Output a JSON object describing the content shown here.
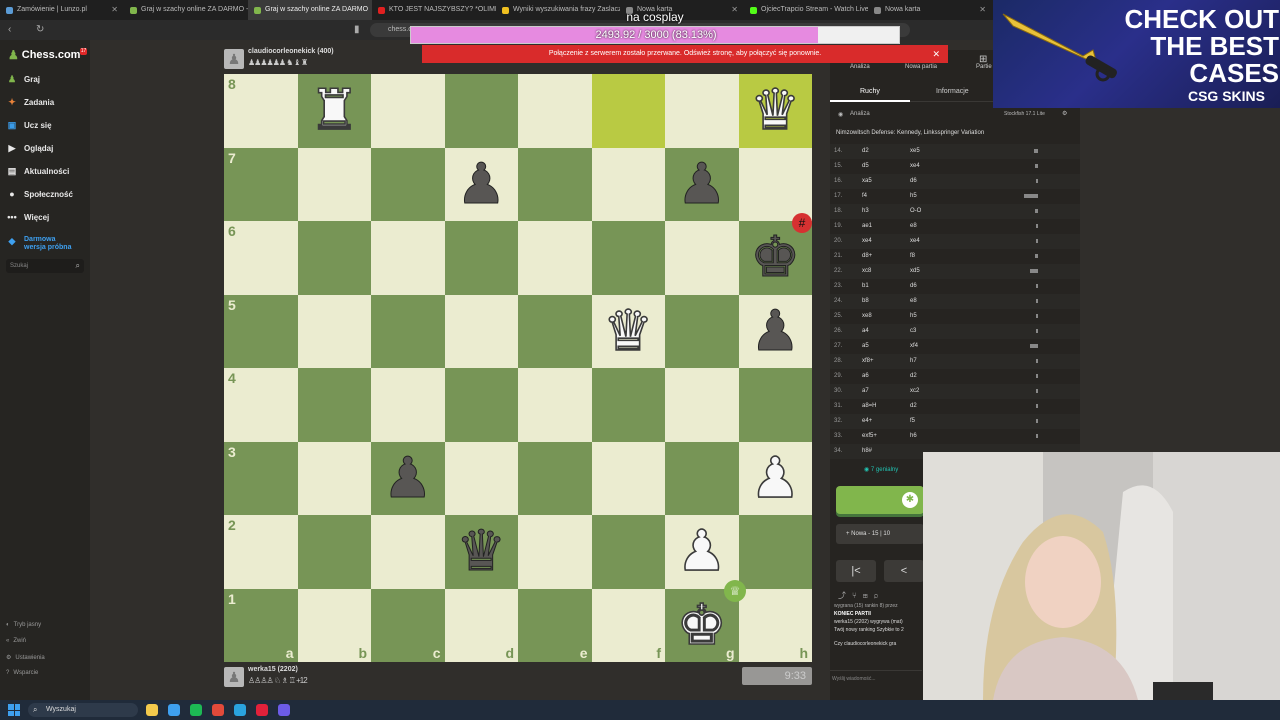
{
  "browser": {
    "tabs": [
      {
        "label": "Zamówienie | Lunzo.pl",
        "color": "#5b9bd5",
        "active": false
      },
      {
        "label": "Graj w szachy online ZA DARMO - in",
        "color": "#81b64c",
        "active": false
      },
      {
        "label": "Graj w szachy online ZA DARMO",
        "color": "#81b64c",
        "active": true
      },
      {
        "label": "KTO JEST NAJSZYBSZY? *OLIMPIAD",
        "color": "#e02020",
        "active": false
      },
      {
        "label": "Wyniki wyszukiwania frazy Zaslacz d",
        "color": "#f0c020",
        "active": false
      },
      {
        "label": "Nowa karta",
        "color": "#888888",
        "active": false
      },
      {
        "label": "OjciecTrapcio Stream - Watch Live on",
        "color": "#53fc18",
        "active": false
      },
      {
        "label": "Nowa karta",
        "color": "#888888",
        "active": false
      }
    ],
    "url": "chess.c"
  },
  "overlay": {
    "cosplay": "na cosplay",
    "goal_text": "2493.92 / 3000 (83.13%)",
    "goal_fraction": 0.8313,
    "alert": "Połączenie z serwerem zostało przerwane. Odśwież stronę, aby połączyć się ponownie."
  },
  "sidebar": {
    "logo": "Chess.com",
    "badge": "17",
    "items": [
      {
        "label": "Graj",
        "icon": "♟",
        "color": "#81b64c"
      },
      {
        "label": "Zadania",
        "icon": "✦",
        "color": "#e8823a"
      },
      {
        "label": "Ucz się",
        "icon": "▣",
        "color": "#3a9be8"
      },
      {
        "label": "Oglądaj",
        "icon": "▶",
        "color": "#e8e8e8"
      },
      {
        "label": "Aktualności",
        "icon": "▤",
        "color": "#e8e8e8"
      },
      {
        "label": "Społeczność",
        "icon": "●",
        "color": "#e8e8e8"
      },
      {
        "label": "Więcej",
        "icon": "•••",
        "color": "#e8e8e8"
      }
    ],
    "trial_line1": "Darmowa",
    "trial_line2": "wersja próbna",
    "search_placeholder": "Szukaj",
    "footer": [
      {
        "label": "Tryb jasny",
        "icon": "◐"
      },
      {
        "label": "Zwiń",
        "icon": "«"
      },
      {
        "label": "Ustawienia",
        "icon": "⚙"
      },
      {
        "label": "Wsparcie",
        "icon": "?"
      }
    ]
  },
  "top_player": {
    "name": "claudiocorleonekick (400)",
    "captures": "♟♟♟♟♟♟ ♞ ♝ ♜"
  },
  "bottom_player": {
    "name": "werka15 (2202)",
    "captures": "♙♙♙♙ ♘ ♗ ♖ +12",
    "clock": "9:33"
  },
  "board": {
    "files": [
      "a",
      "b",
      "c",
      "d",
      "e",
      "f",
      "g",
      "h"
    ],
    "ranks": [
      "8",
      "7",
      "6",
      "5",
      "4",
      "3",
      "2",
      "1"
    ],
    "highlight": [
      "f8",
      "h8"
    ],
    "pieces": {
      "b8": {
        "glyph": "♜",
        "color": "w",
        "name": "white-rook"
      },
      "h8": {
        "glyph": "♛",
        "color": "w",
        "name": "white-queen"
      },
      "d7": {
        "glyph": "♟",
        "color": "b",
        "name": "black-pawn"
      },
      "g7": {
        "glyph": "♟",
        "color": "b",
        "name": "black-pawn"
      },
      "h6": {
        "glyph": "♚",
        "color": "b",
        "name": "black-king"
      },
      "f5": {
        "glyph": "♛",
        "color": "w",
        "name": "white-queen"
      },
      "h5": {
        "glyph": "♟",
        "color": "b",
        "name": "black-pawn"
      },
      "c3": {
        "glyph": "♟",
        "color": "b",
        "name": "black-pawn"
      },
      "h3": {
        "glyph": "♟",
        "color": "w",
        "name": "white-pawn"
      },
      "d2": {
        "glyph": "♛",
        "color": "b",
        "name": "black-queen"
      },
      "g2": {
        "glyph": "♟",
        "color": "w",
        "name": "white-pawn"
      },
      "g1": {
        "glyph": "♚",
        "color": "w",
        "name": "white-king"
      }
    },
    "checkmark_icon": "checkmark-icon",
    "winner_icon": "crown-icon"
  },
  "panel": {
    "tabs": [
      "Analiza",
      "Nowa partia",
      "Partie"
    ],
    "subtabs": [
      "Ruchy",
      "Informacje"
    ],
    "engine_label": "Analiza",
    "engine_name": "Stockfish 17.1 Lite",
    "opening": "Nimzowitsch Defense: Kennedy, Linksspringer Variation",
    "moves": [
      {
        "n": "14.",
        "w": "d2",
        "b": "xe5",
        "bar": 4
      },
      {
        "n": "15.",
        "w": "d5",
        "b": "xe4",
        "bar": 3
      },
      {
        "n": "16.",
        "w": "xa5",
        "b": "d6",
        "bar": 2
      },
      {
        "n": "17.",
        "w": "f4",
        "b": "h5",
        "bar": 14
      },
      {
        "n": "18.",
        "w": "h3",
        "b": "O-O",
        "bar": 3
      },
      {
        "n": "19.",
        "w": "ae1",
        "b": "e8",
        "bar": 2
      },
      {
        "n": "20.",
        "w": "xe4",
        "b": "xe4",
        "bar": 2
      },
      {
        "n": "21.",
        "w": "d8+",
        "b": "f8",
        "bar": 3
      },
      {
        "n": "22.",
        "w": "xc8",
        "b": "xd5",
        "bar": 8
      },
      {
        "n": "23.",
        "w": "b1",
        "b": "d6",
        "bar": 2
      },
      {
        "n": "24.",
        "w": "b8",
        "b": "e8",
        "bar": 2
      },
      {
        "n": "25.",
        "w": "xe8",
        "b": "h5",
        "bar": 2
      },
      {
        "n": "26.",
        "w": "a4",
        "b": "c3",
        "bar": 2
      },
      {
        "n": "27.",
        "w": "a5",
        "b": "xf4",
        "bar": 8
      },
      {
        "n": "28.",
        "w": "xf8+",
        "b": "h7",
        "bar": 2
      },
      {
        "n": "29.",
        "w": "a6",
        "b": "d2",
        "bar": 2
      },
      {
        "n": "30.",
        "w": "a7",
        "b": "xc2",
        "bar": 2
      },
      {
        "n": "31.",
        "w": "a8=H",
        "b": "d2",
        "bar": 2
      },
      {
        "n": "32.",
        "w": "e4+",
        "b": "f5",
        "bar": 2
      },
      {
        "n": "33.",
        "w": "exf5+",
        "b": "h6",
        "bar": 2
      },
      {
        "n": "34.",
        "w": "h8#",
        "b": "",
        "bar": 0
      }
    ],
    "brilliant": "7 genialny",
    "new_game": "Nowa - 15 | 10",
    "nav_first": "|<",
    "nav_prev": "<",
    "chat_line1": "wygrana (15) rankin 8) przez",
    "game_over": "KONIEC PARTII",
    "chat_line2": "werka15 (2202) wygrywa (mat)",
    "chat_line3": "Twój nowy ranking Szybkie to 2",
    "chat_line4": "Czy claudiocorleonekick gra",
    "message_placeholder": "Wyślij wiadomość..."
  },
  "ad": {
    "title": "CHECK OUT THE BEST CASES",
    "brand": "CSG SKINS"
  },
  "taskbar": {
    "search": "Wyszukaj",
    "apps": [
      {
        "name": "file-explorer-icon",
        "color": "#f2c94c"
      },
      {
        "name": "store-icon",
        "color": "#3ea0f0"
      },
      {
        "name": "spotify-icon",
        "color": "#1db954"
      },
      {
        "name": "chrome-icon",
        "color": "#e04a3a"
      },
      {
        "name": "telegram-icon",
        "color": "#2aa3df"
      },
      {
        "name": "opera-icon",
        "color": "#e0213a"
      },
      {
        "name": "discord-icon",
        "color": "#6c5ce7"
      }
    ]
  }
}
